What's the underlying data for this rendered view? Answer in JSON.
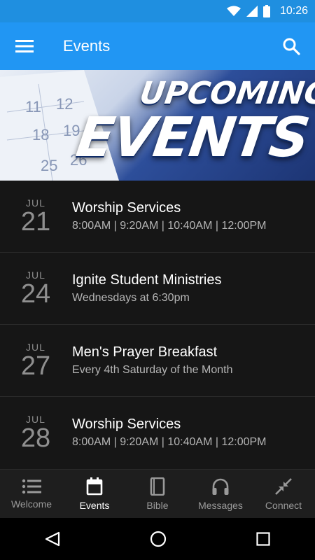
{
  "status": {
    "time": "10:26"
  },
  "appbar": {
    "title": "Events"
  },
  "banner": {
    "line1": "UPCOMING",
    "line2": "EVENTS",
    "calendar_numbers": [
      "11",
      "18",
      "25",
      "12",
      "19",
      "26"
    ]
  },
  "events": [
    {
      "month": "JUL",
      "day": "21",
      "title": "Worship Services",
      "subtitle": "8:00AM | 9:20AM | 10:40AM | 12:00PM"
    },
    {
      "month": "JUL",
      "day": "24",
      "title": "Ignite Student Ministries",
      "subtitle": "Wednesdays at 6:30pm"
    },
    {
      "month": "JUL",
      "day": "27",
      "title": "Men's Prayer Breakfast",
      "subtitle": "Every 4th Saturday of the Month"
    },
    {
      "month": "JUL",
      "day": "28",
      "title": "Worship Services",
      "subtitle": "8:00AM | 9:20AM | 10:40AM | 12:00PM"
    }
  ],
  "nav": [
    {
      "label": "Welcome",
      "icon": "list-icon"
    },
    {
      "label": "Events",
      "icon": "calendar-icon"
    },
    {
      "label": "Bible",
      "icon": "book-icon"
    },
    {
      "label": "Messages",
      "icon": "headphones-icon"
    },
    {
      "label": "Connect",
      "icon": "connect-icon"
    }
  ],
  "colors": {
    "primary": "#2196f3",
    "statusbar": "#1f8fe0",
    "background": "#161616"
  }
}
